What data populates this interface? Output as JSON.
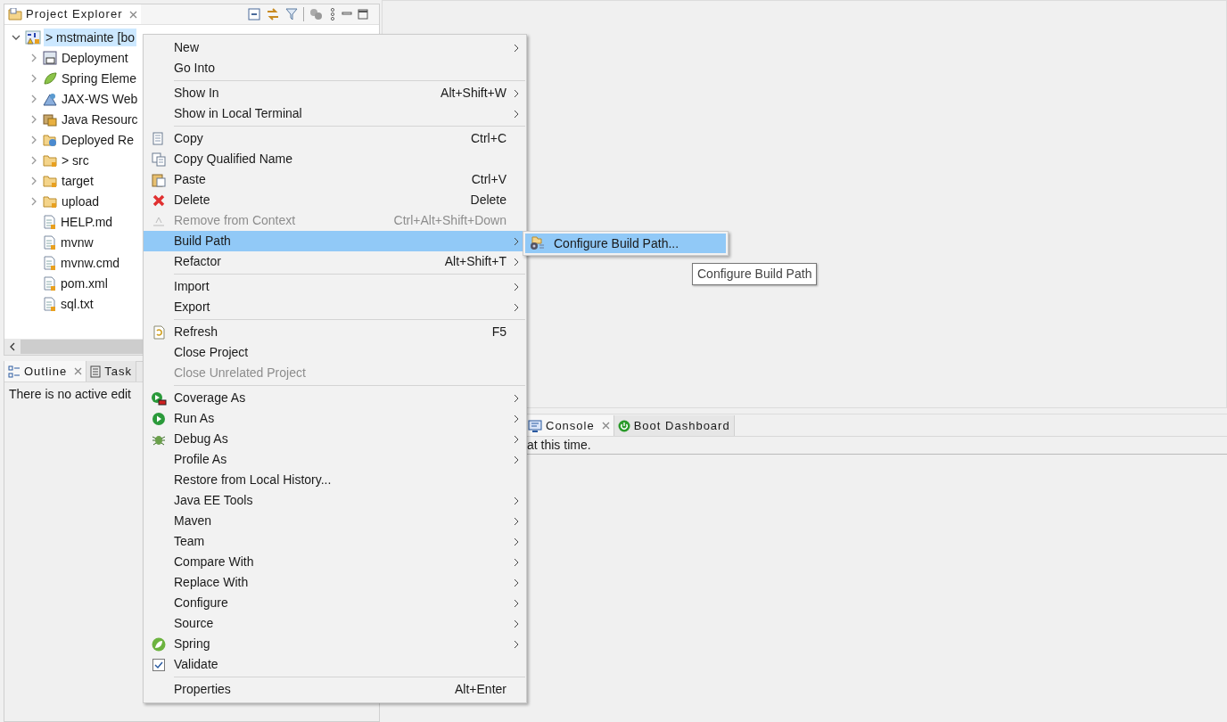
{
  "explorer": {
    "title": "Project Explorer",
    "tree": [
      {
        "kind": "node",
        "label": "> mstmainte [bo",
        "expanded": true,
        "selected": true,
        "children": [
          {
            "kind": "node",
            "label": "Deployment",
            "expanded": false,
            "selected": false
          },
          {
            "kind": "node",
            "label": "Spring Eleme",
            "expanded": false,
            "selected": false
          },
          {
            "kind": "node",
            "label": "JAX-WS Web",
            "expanded": false,
            "selected": false
          },
          {
            "kind": "node",
            "label": "Java Resourc",
            "expanded": false,
            "selected": false
          },
          {
            "kind": "node",
            "label": "Deployed Re",
            "expanded": false,
            "selected": false
          },
          {
            "kind": "node",
            "label": "> src",
            "expanded": false,
            "selected": false
          },
          {
            "kind": "node",
            "label": "target",
            "expanded": false,
            "selected": false
          },
          {
            "kind": "node",
            "label": "upload",
            "expanded": false,
            "selected": false
          },
          {
            "kind": "file",
            "label": "HELP.md",
            "selected": false
          },
          {
            "kind": "file",
            "label": "mvnw",
            "selected": false
          },
          {
            "kind": "file",
            "label": "mvnw.cmd",
            "selected": false
          },
          {
            "kind": "file",
            "label": "pom.xml",
            "selected": false
          },
          {
            "kind": "file",
            "label": "sql.txt",
            "selected": false
          }
        ]
      }
    ]
  },
  "outline": {
    "tabs": [
      {
        "label": "Outline",
        "selected": true
      },
      {
        "label": "Task",
        "selected": false
      }
    ],
    "message": "There is no active edit"
  },
  "console": {
    "tabs": [
      {
        "label": "Console",
        "selected": true
      },
      {
        "label": "Boot Dashboard",
        "selected": false
      }
    ],
    "message": "at this time."
  },
  "context_menu": {
    "items": [
      {
        "kind": "item",
        "label": "New",
        "submenu": true,
        "disabled": false,
        "selected": false
      },
      {
        "kind": "item",
        "label": "Go Into",
        "submenu": false,
        "disabled": false,
        "selected": false
      },
      {
        "kind": "separator"
      },
      {
        "kind": "item",
        "label": "Show In",
        "shortcut": "Alt+Shift+W",
        "submenu": true,
        "disabled": false,
        "selected": false
      },
      {
        "kind": "item",
        "label": "Show in Local Terminal",
        "submenu": true,
        "disabled": false,
        "selected": false
      },
      {
        "kind": "separator"
      },
      {
        "kind": "item",
        "label": "Copy",
        "shortcut": "Ctrl+C",
        "submenu": false,
        "disabled": false,
        "selected": false
      },
      {
        "kind": "item",
        "label": "Copy Qualified Name",
        "submenu": false,
        "disabled": false,
        "selected": false
      },
      {
        "kind": "item",
        "label": "Paste",
        "shortcut": "Ctrl+V",
        "submenu": false,
        "disabled": false,
        "selected": false
      },
      {
        "kind": "item",
        "label": "Delete",
        "shortcut": "Delete",
        "submenu": false,
        "disabled": false,
        "selected": false
      },
      {
        "kind": "item",
        "label": "Remove from Context",
        "shortcut": "Ctrl+Alt+Shift+Down",
        "submenu": false,
        "disabled": true,
        "selected": false
      },
      {
        "kind": "item",
        "label": "Build Path",
        "submenu": true,
        "disabled": false,
        "selected": true
      },
      {
        "kind": "item",
        "label": "Refactor",
        "shortcut": "Alt+Shift+T",
        "submenu": true,
        "disabled": false,
        "selected": false
      },
      {
        "kind": "separator"
      },
      {
        "kind": "item",
        "label": "Import",
        "submenu": true,
        "disabled": false,
        "selected": false
      },
      {
        "kind": "item",
        "label": "Export",
        "submenu": true,
        "disabled": false,
        "selected": false
      },
      {
        "kind": "separator"
      },
      {
        "kind": "item",
        "label": "Refresh",
        "shortcut": "F5",
        "submenu": false,
        "disabled": false,
        "selected": false
      },
      {
        "kind": "item",
        "label": "Close Project",
        "submenu": false,
        "disabled": false,
        "selected": false
      },
      {
        "kind": "item",
        "label": "Close Unrelated Project",
        "submenu": false,
        "disabled": true,
        "selected": false
      },
      {
        "kind": "separator"
      },
      {
        "kind": "item",
        "label": "Coverage As",
        "submenu": true,
        "disabled": false,
        "selected": false
      },
      {
        "kind": "item",
        "label": "Run As",
        "submenu": true,
        "disabled": false,
        "selected": false
      },
      {
        "kind": "item",
        "label": "Debug As",
        "submenu": true,
        "disabled": false,
        "selected": false
      },
      {
        "kind": "item",
        "label": "Profile As",
        "submenu": true,
        "disabled": false,
        "selected": false
      },
      {
        "kind": "item",
        "label": "Restore from Local History...",
        "submenu": false,
        "disabled": false,
        "selected": false
      },
      {
        "kind": "item",
        "label": "Java EE Tools",
        "submenu": true,
        "disabled": false,
        "selected": false
      },
      {
        "kind": "item",
        "label": "Maven",
        "submenu": true,
        "disabled": false,
        "selected": false
      },
      {
        "kind": "item",
        "label": "Team",
        "submenu": true,
        "disabled": false,
        "selected": false
      },
      {
        "kind": "item",
        "label": "Compare With",
        "submenu": true,
        "disabled": false,
        "selected": false
      },
      {
        "kind": "item",
        "label": "Replace With",
        "submenu": true,
        "disabled": false,
        "selected": false
      },
      {
        "kind": "item",
        "label": "Configure",
        "submenu": true,
        "disabled": false,
        "selected": false
      },
      {
        "kind": "item",
        "label": "Source",
        "submenu": true,
        "disabled": false,
        "selected": false
      },
      {
        "kind": "item",
        "label": "Spring",
        "submenu": true,
        "disabled": false,
        "selected": false
      },
      {
        "kind": "item",
        "label": "Validate",
        "submenu": false,
        "disabled": false,
        "selected": false
      },
      {
        "kind": "separator"
      },
      {
        "kind": "item",
        "label": "Properties",
        "shortcut": "Alt+Enter",
        "submenu": false,
        "disabled": false,
        "selected": false
      }
    ]
  },
  "submenu": {
    "items": [
      {
        "label": "Configure Build Path...",
        "selected": true
      }
    ]
  },
  "tooltip": "Configure Build Path"
}
